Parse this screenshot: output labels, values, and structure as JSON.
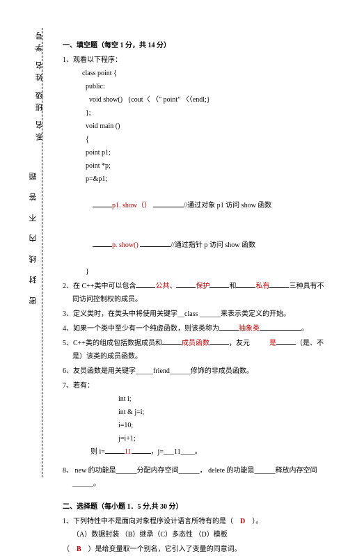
{
  "sideband": {
    "vertical_text": "系名            班级            姓名            学号",
    "sealed_text": "密 封 线 内 不 答 题"
  },
  "section1": {
    "header": "一、填空题（每空 1 分，共 14 分）",
    "q1_lead": "1、观看以下程序：",
    "code": {
      "l1": "class point {",
      "l2": "  public:",
      "l3": "    void show()   {cout〈 〈\" point\" 〈〈endl;}",
      "l4": "  };",
      "l5": "  void main ()",
      "l6": "  {",
      "l7": "  point p1;",
      "l8": "  point *p;",
      "l9": "  p=&p1;",
      "l10a_ans": "p1. show（）",
      "l10b": "//通过对象 p1 访问 show 函数",
      "l11a_ans": "p. show()",
      "l11b": "//通过指针 p 访问 show 函数",
      "l12": "  }"
    },
    "q2_a": "2、在 C++类中可以包含",
    "q2_ans1": "公共",
    "q2_b": "、",
    "q2_ans2": "保护",
    "q2_c": "和",
    "q2_ans3": "私有",
    "q2_d": "三种具有不同访问控制权的成员。",
    "q3": "3、定义类时，在类头中将使用关键字__class ______来表示类定义的开始。",
    "q4_a": "4、如果一个类中至少有一个纯虚函数，则该类称为",
    "q4_ans": "抽象类",
    "q4_b": "。",
    "q5_a": "5、C++类的组成包括数据成员和",
    "q5_ans1": "成员函数",
    "q5_b": "，友元",
    "q5_ans2": "是",
    "q5_c": "（是、不是）该类的成员函数。",
    "q6": "6、友员函数是用关键字_____friend______修饰的非成员函数。",
    "q7_lead": "7、若有：",
    "q7_code": {
      "c1": "int i;",
      "c2": "int & j=i;",
      "c3": "i=10;",
      "c4": "j=i+1;"
    },
    "q7_res_a": "则 i=",
    "q7_res_ans1": "11",
    "q7_res_b": "，j=___11____。",
    "q8": "8、 new 的功能是______分配内存空间______， delete 的功能是______释放内存空间______。"
  },
  "section2": {
    "header": "二、选择题（每小题 1．5 分,共 30 分）",
    "q1_a": "1、下列特性中不是面向对象程序设计语言所特有的是（",
    "q1_ans": "D",
    "q1_b": "）。",
    "q1_opts": "（A）数据封装 （B）继承（C）多态性 （D）模板",
    "q2_a": "（",
    "q2_ans": "B",
    "q2_b": "）是给变量取一个别名，它引入了变量的同意词。"
  }
}
